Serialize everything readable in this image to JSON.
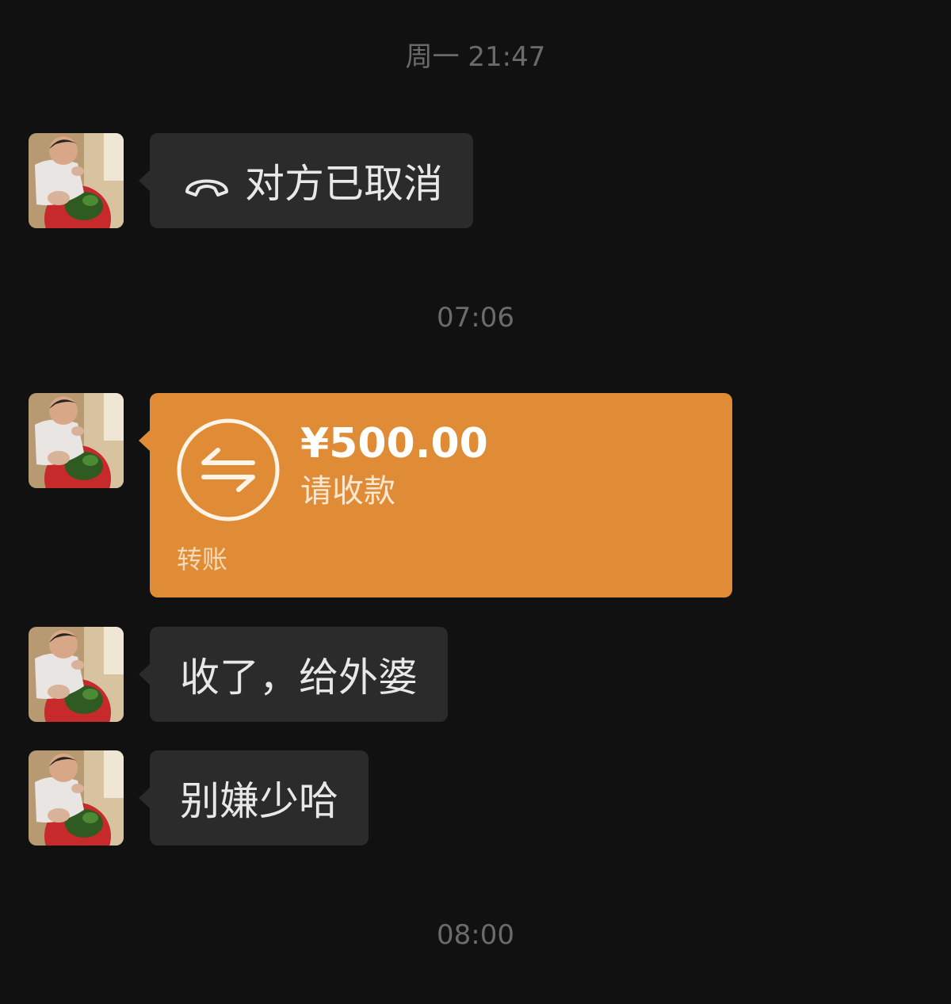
{
  "timestamps": [
    "周一 21:47",
    "07:06",
    "08:00"
  ],
  "messages": {
    "call": {
      "icon": "hang-up-phone-icon",
      "text": "对方已取消"
    },
    "transfer": {
      "icon": "transfer-arrows-icon",
      "amount": "¥500.00",
      "status": "请收款",
      "label": "转账",
      "color": "#e08c36"
    },
    "text1": "收了，给外婆",
    "text2": "别嫌少哈"
  },
  "theme": {
    "background": "#111111",
    "bubble": "#2b2b2b",
    "time_text": "#6b6b6b"
  }
}
